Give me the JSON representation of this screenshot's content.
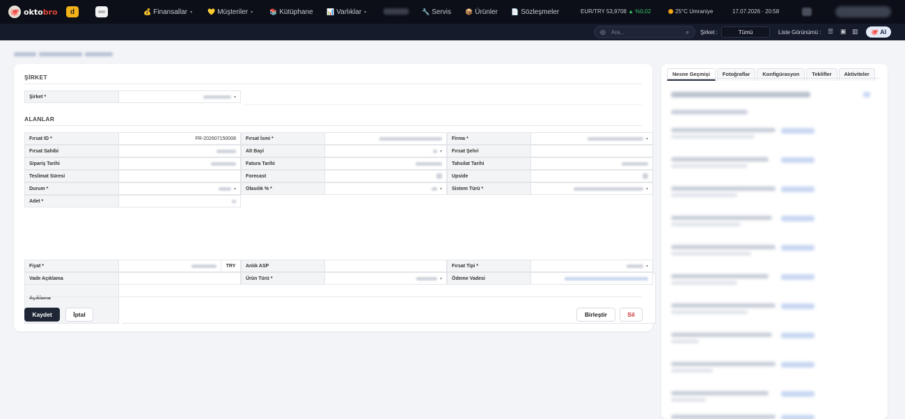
{
  "brand": {
    "name_a": "okto",
    "name_b": "bro",
    "app1": "d",
    "app2": ""
  },
  "nav": [
    {
      "icon": "💰",
      "label": "Finansallar",
      "caret": "▾"
    },
    {
      "icon": "💛",
      "label": "Müşteriler",
      "caret": "▾"
    },
    {
      "icon": "📚",
      "label": "Kütüphane",
      "caret": ""
    },
    {
      "icon": "📊",
      "label": "Varlıklar",
      "caret": "▾"
    },
    {
      "icon": "🔧",
      "label": "Servis",
      "caret": ""
    },
    {
      "icon": "📦",
      "label": "Ürünler",
      "caret": ""
    },
    {
      "icon": "📄",
      "label": "Sözleşmeler",
      "caret": ""
    }
  ],
  "rate": {
    "pair": "EUR/TRY 53,9708",
    "change": "▲ %0,02"
  },
  "weather": "25°C Umraniye",
  "datetime": "17.07.2026 · 20:58",
  "toolbar": {
    "search_placeholder": "Ara...",
    "company_label": "Şirket :",
    "company_value": "Tümü",
    "list_view_label": "Liste Görünümü :",
    "ai_label": "AI"
  },
  "form": {
    "section_company": "ŞİRKET",
    "company_field_label": "Şirket *",
    "section_fields": "ALANLAR",
    "rows": [
      [
        {
          "l": "Fırsat ID *",
          "v": "FR-202607150008"
        },
        {
          "l": "Fırsat İsmi *",
          "v": ""
        },
        {
          "l": "Firma *",
          "v": ""
        }
      ],
      [
        {
          "l": "Fırsat Sahibi",
          "v": ""
        },
        {
          "l": "Alt Bayi",
          "v": ""
        },
        {
          "l": "Fırsat Şehri",
          "v": ""
        }
      ],
      [
        {
          "l": "Sipariş Tarihi",
          "v": ""
        },
        {
          "l": "Fatura Tarihi",
          "v": ""
        },
        {
          "l": "Tahsilat Tarihi",
          "v": ""
        }
      ],
      [
        {
          "l": "Teslimat Süresi",
          "v": ""
        },
        {
          "l": "Forecast",
          "v": ""
        },
        {
          "l": "Upside",
          "v": ""
        }
      ],
      [
        {
          "l": "Durum *",
          "v": ""
        },
        {
          "l": "Olasılık % *",
          "v": ""
        },
        {
          "l": "Sistem Türü *",
          "v": ""
        }
      ],
      [
        {
          "l": "Adet *",
          "v": ""
        }
      ]
    ],
    "description_label": "Açıklama",
    "price_label": "Fiyat *",
    "currency": "TRY",
    "asp_label": "Anlık ASP",
    "opportunity_type_label": "Fırsat Tipi *",
    "maturity_desc_label": "Vade Açıklama",
    "product_type_label": "Ürün Türü *",
    "payment_term_label": "Ödeme Vadesi",
    "save": "Kaydet",
    "cancel": "İptal",
    "merge": "Birleştir",
    "delete": "Sil"
  },
  "panel": {
    "tabs": [
      "Nesne Geçmişi",
      "Fotoğraflar",
      "Konfigürasyon",
      "Teklifler",
      "Aktiviteler"
    ]
  }
}
